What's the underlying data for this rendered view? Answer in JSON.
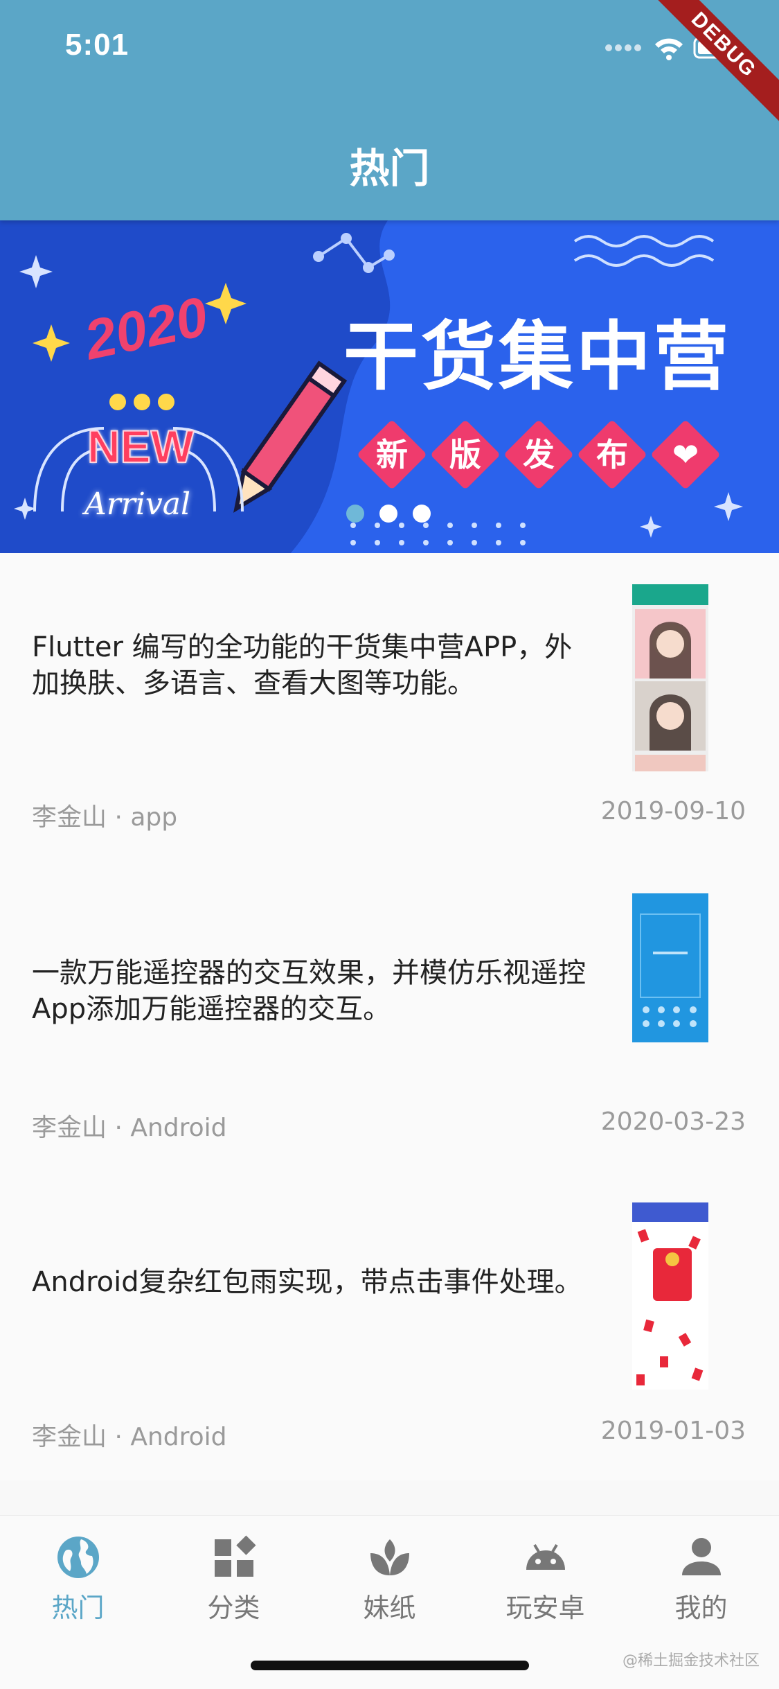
{
  "status_bar": {
    "time": "5:01"
  },
  "app_bar": {
    "title": "热门",
    "debug_label": "DEBUG"
  },
  "banner": {
    "year": "2020",
    "new_label": "NEW",
    "arrival_label": "Arrival",
    "title": "干货集中营",
    "tags": [
      "新",
      "版",
      "发",
      "布",
      "❤"
    ],
    "pager": {
      "count": 3,
      "active_index": 0
    }
  },
  "articles": [
    {
      "text": "Flutter 编写的全功能的干货集中营APP，外加换肤、多语言、查看大图等功能。",
      "meta": "李金山 · app",
      "date": "2019-09-10",
      "thumb": "gallery-app-screenshot"
    },
    {
      "text": "一款万能遥控器的交互效果，并模仿乐视遥控App添加万能遥控器的交互。",
      "meta": "李金山 · Android",
      "date": "2020-03-23",
      "thumb": "remote-control-screenshot"
    },
    {
      "text": "Android复杂红包雨实现，带点击事件处理。",
      "meta": "李金山 · Android",
      "date": "2019-01-03",
      "thumb": "red-packet-rain-screenshot"
    }
  ],
  "bottom_nav": {
    "active": "热门",
    "items": [
      {
        "label": "热门",
        "icon": "globe-icon"
      },
      {
        "label": "分类",
        "icon": "category-icon"
      },
      {
        "label": "妹纸",
        "icon": "spa-icon"
      },
      {
        "label": "玩安卓",
        "icon": "android-icon"
      },
      {
        "label": "我的",
        "icon": "person-icon"
      }
    ]
  },
  "watermark": "@稀土掘金技术社区",
  "colors": {
    "primary": "#5ba6c7",
    "banner_bg": "#2456e0",
    "accent_pink": "#ef3b6d",
    "meta_gray": "#9a9a9a",
    "nav_inactive": "#777777"
  }
}
